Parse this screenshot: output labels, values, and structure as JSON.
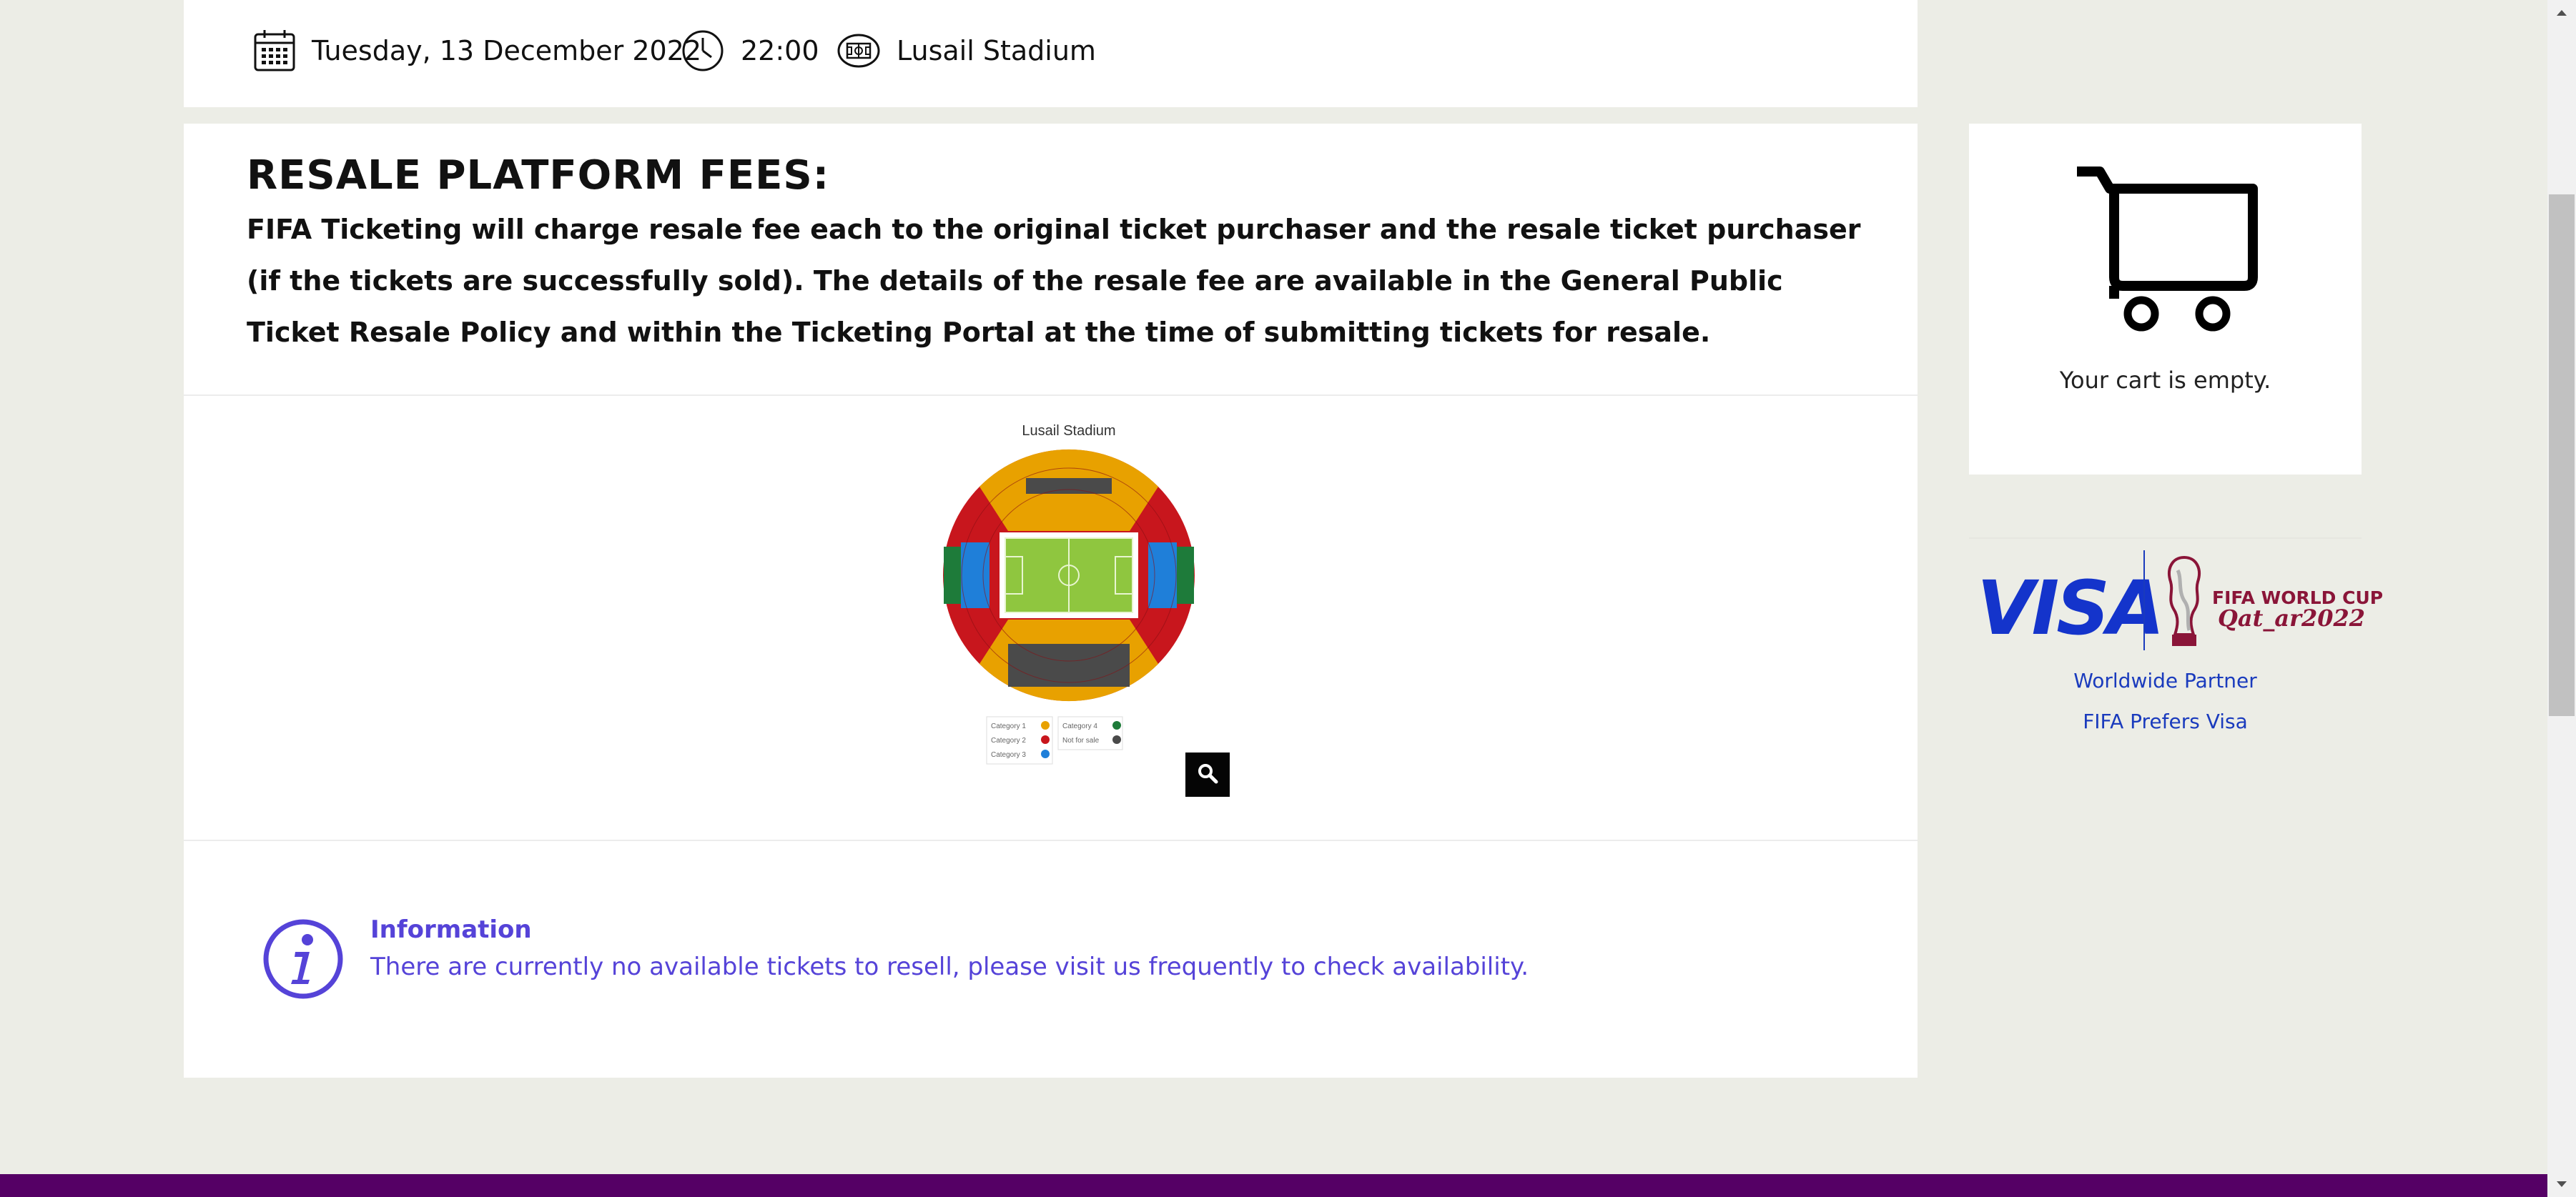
{
  "match": {
    "date": "Tuesday, 13 December 2022",
    "time": "22:00",
    "venue": "Lusail Stadium",
    "date_icon": "calendar-icon",
    "time_icon": "clock-icon",
    "venue_icon": "stadium-icon"
  },
  "fees": {
    "title": "RESALE PLATFORM FEES:",
    "text": "FIFA Ticketing will charge resale fee each to the original ticket purchaser and the resale ticket purchaser (if the tickets are successfully sold). The details of the resale fee are available in the General Public Ticket Resale Policy and within the Ticketing Portal at the time of submitting tickets for resale."
  },
  "stadium_map": {
    "title": "Lusail Stadium",
    "legend": [
      {
        "label": "Category 1",
        "color": "#e8a100"
      },
      {
        "label": "Category 2",
        "color": "#c8161d"
      },
      {
        "label": "Category 3",
        "color": "#1f7fd9"
      },
      {
        "label": "Category 4",
        "color": "#1e7b3a"
      },
      {
        "label": "Not for sale",
        "color": "#4a4a4a"
      }
    ],
    "zoom_icon": "search-icon"
  },
  "information": {
    "icon": "info-icon",
    "title": "Information",
    "message": "There are currently no available tickets to resell, please visit us frequently to check availability.",
    "color": "#5543d8"
  },
  "cart": {
    "icon": "shopping-cart-icon",
    "empty_text": "Your cart is empty."
  },
  "sponsor": {
    "brand": "VISA",
    "event_line1": "FIFA WORLD CUP",
    "event_line2": "Qat_ar2022",
    "links": [
      "Worldwide Partner",
      "FIFA Prefers Visa"
    ],
    "brand_color": "#1434cb"
  },
  "footer": {
    "color": "#550065"
  }
}
